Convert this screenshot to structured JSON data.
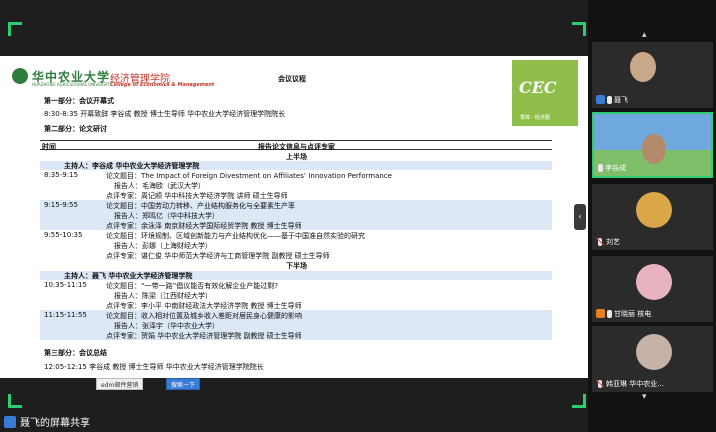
{
  "doc": {
    "logo_cn": "华中农业大学",
    "logo_en": "HUAZHONG AGRICULTURAL UNIVERSITY",
    "college_cn": "经济管理学院",
    "college_en": "College of Economics & Management",
    "title": "会议议程",
    "cec_logo": "CEC",
    "cec_sub": "香樟 · 经济圈",
    "part1_title": "第一部分：会议开幕式",
    "part1_line": "8:30-8:35  开幕致辞  李谷成 教授  博士生导师  华中农业大学经济管理学院院长",
    "part2_title": "第二部分：论文研讨",
    "table_head_time": "时间",
    "table_head_info": "报告论文信息与点评专家",
    "first_half": "上半场",
    "host1": "主持人：李谷成   华中农业大学经济管理学院",
    "s1_time": "8:35-9:15",
    "s1_paper": "论文题目：The Impact of Foreign Divestment on Affiliates’  Innovation Performance",
    "s1_reporter": "报告人：毛海欧（武汉大学）",
    "s1_reviewer": "点评专家：周记顺 华中科技大学经济学院  讲师  硕士生导师",
    "s2_time": "9:15-9:55",
    "s2_paper": "论文题目：中国劳动力转移、产业结构服务化与全要素生产率",
    "s2_reporter": "报告人：郑鸣亿（华中科技大学）",
    "s2_reviewer": "点评专家：余泳泽 南京财经大学国际经贸学院 教授 博士生导师",
    "s3_time": "9:55-10:35",
    "s3_paper": "论文题目：环境规制、区域创新能力与产业结构优化——基于中国准自然实验的研究",
    "s3_reporter": "报告人：彭娜（上海财经大学）",
    "s3_reviewer": "点评专家：谌仁俊 华中师范大学经济与工商管理学院 副教授 硕士生导师",
    "second_half": "下半场",
    "host2": "主持人：聂飞   华中农业大学经济管理学院",
    "s4_time": "10:35-11:15",
    "s4_paper": "论文题目：“一带一路”倡议能否有效化解企业产能过剩?",
    "s4_reporter": "报告人：陈梁（江西财经大学）",
    "s4_reviewer": "点评专家：李小平  中南财经政法大学经济学院 教授 博士生导师",
    "s5_time": "11:15-11:55",
    "s5_paper": "论文题目：收入相对位置及城乡收入差距对居民身心健康的影响",
    "s5_reporter": "报告人：张泽宇（华中农业大学）",
    "s5_reviewer": "点评专家：贺娟 华中农业大学经济管理学院 副教授 硕士生导师",
    "part3_title": "第三部分：会议总结",
    "part3_line": "12:05-12:15 李谷成 教授 博士生导师 华中农业大学经济管理学院院长"
  },
  "taskbar": {
    "item1": "edm邮件营销",
    "item2": "搜索一下"
  },
  "share_label": "聂飞的屏幕共享",
  "collapse_glyph": "‹",
  "participants": [
    {
      "name": "聂飞"
    },
    {
      "name": "李谷成"
    },
    {
      "name": "刘艺"
    },
    {
      "name": "甘晓丽 核电"
    },
    {
      "name": "韩亚琳 华中农业..."
    }
  ],
  "colors": {
    "active_border": "#2ecc71",
    "highlight_band": "#dce8f5",
    "college_red": "#c0392b",
    "brand_green": "#2f7d3a"
  }
}
